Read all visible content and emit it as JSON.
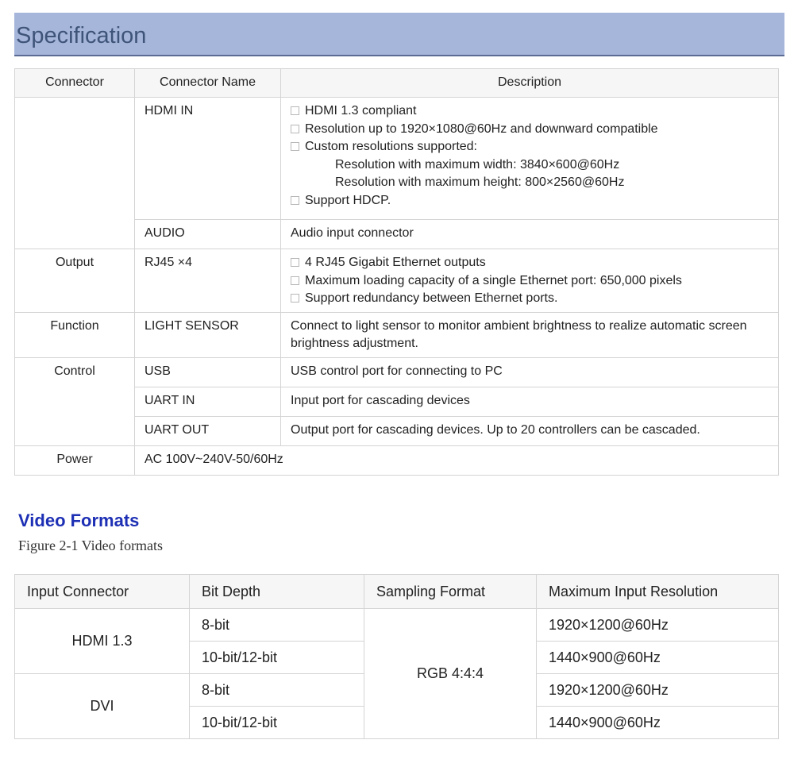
{
  "spec": {
    "title": "Specification",
    "headers": {
      "connector": "Connector",
      "name": "Connector Name",
      "description": "Description"
    },
    "hdmi": {
      "name": "HDMI IN",
      "b1": "HDMI 1.3 compliant",
      "b2": "Resolution up to 1920×1080@60Hz and downward compatible",
      "b3": "Custom resolutions supported:",
      "s1": "Resolution with maximum width: 3840×600@60Hz",
      "s2": "Resolution with maximum height: 800×2560@60Hz",
      "b4": "Support HDCP."
    },
    "audio": {
      "name": "AUDIO",
      "desc": "Audio input connector"
    },
    "output": {
      "connector": "Output",
      "name": "RJ45 ×4",
      "b1": "4 RJ45 Gigabit Ethernet outputs",
      "b2": "Maximum loading capacity of a single Ethernet port: 650,000 pixels",
      "b3": "Support redundancy between Ethernet ports."
    },
    "function": {
      "connector": "Function",
      "name": "LIGHT SENSOR",
      "desc": "Connect to light sensor to monitor ambient brightness to realize automatic screen brightness adjustment."
    },
    "control": {
      "connector": "Control",
      "usb_name": "USB",
      "usb_desc": "USB control port for connecting to PC",
      "uartin_name": "UART IN",
      "uartin_desc": "Input port for cascading devices",
      "uartout_name": "UART OUT",
      "uartout_desc": "Output port for cascading devices. Up to 20 controllers can be cascaded."
    },
    "power": {
      "connector": "Power",
      "value": "AC 100V~240V-50/60Hz"
    }
  },
  "video": {
    "title": "Video Formats",
    "caption": "Figure 2-1 Video formats",
    "headers": {
      "input": "Input Connector",
      "depth": "Bit Depth",
      "sampling": "Sampling Format",
      "maxres": "Maximum Input Resolution"
    },
    "hdmi_label": "HDMI 1.3",
    "dvi_label": "DVI",
    "sampling_value": "RGB 4:4:4",
    "rows": [
      {
        "depth": "8-bit",
        "res": "1920×1200@60Hz"
      },
      {
        "depth": "10-bit/12-bit",
        "res": "1440×900@60Hz"
      },
      {
        "depth": "8-bit",
        "res": "1920×1200@60Hz"
      },
      {
        "depth": "10-bit/12-bit",
        "res": "1440×900@60Hz"
      }
    ]
  }
}
